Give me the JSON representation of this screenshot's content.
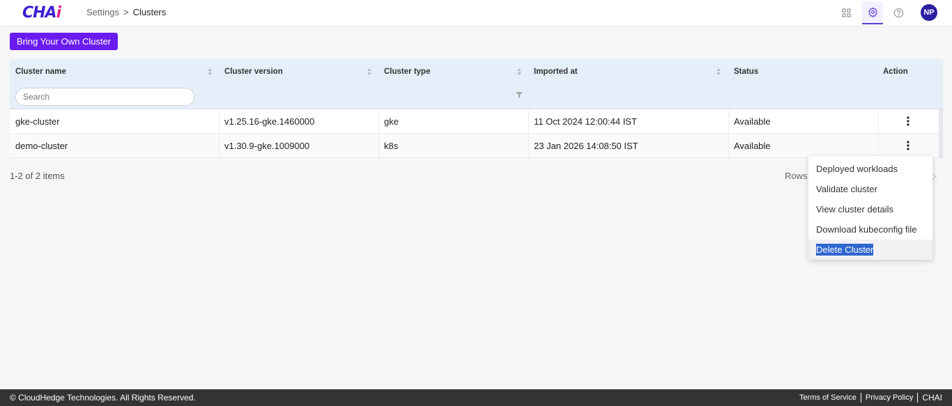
{
  "header": {
    "logo": "CHA",
    "logo_accent": "i",
    "breadcrumb": [
      "Settings",
      "Clusters"
    ],
    "breadcrumb_separator": ">",
    "icons": [
      "apps-grid-icon",
      "gear-icon",
      "help-icon"
    ],
    "avatar_initials": "NP"
  },
  "toolbar": {
    "byoc_label": "Bring Your Own Cluster"
  },
  "table": {
    "columns": [
      "Cluster name",
      "Cluster version",
      "Cluster type",
      "Imported at",
      "Status",
      "Action"
    ],
    "search_placeholder": "Search",
    "rows": [
      {
        "name": "gke-cluster",
        "version": "v1.25.16-gke.1460000",
        "type": "gke",
        "imported": "11 Oct 2024 12:00:44 IST",
        "status": "Available"
      },
      {
        "name": "demo-cluster",
        "version": "v1.30.9-gke.1009000",
        "type": "k8s",
        "imported": "23 Jan 2026 14:08:50 IST",
        "status": "Available"
      }
    ]
  },
  "pagination": {
    "summary": "1-2 of 2 items",
    "rows_label": "Rows"
  },
  "action_menu": {
    "items": [
      "Deployed workloads",
      "Validate cluster",
      "View cluster details",
      "Download kubeconfig file",
      "Delete Cluster"
    ]
  },
  "footer": {
    "copyright": "© CloudHedge Technologies. All Rights Reserved.",
    "links": [
      "Terms of Service",
      "Privacy Policy",
      "CHAI"
    ]
  },
  "colors": {
    "accent": "#6a1cf0",
    "header_bg": "#e6eff9",
    "footer_bg": "#333333",
    "selection": "#2f66cf"
  }
}
